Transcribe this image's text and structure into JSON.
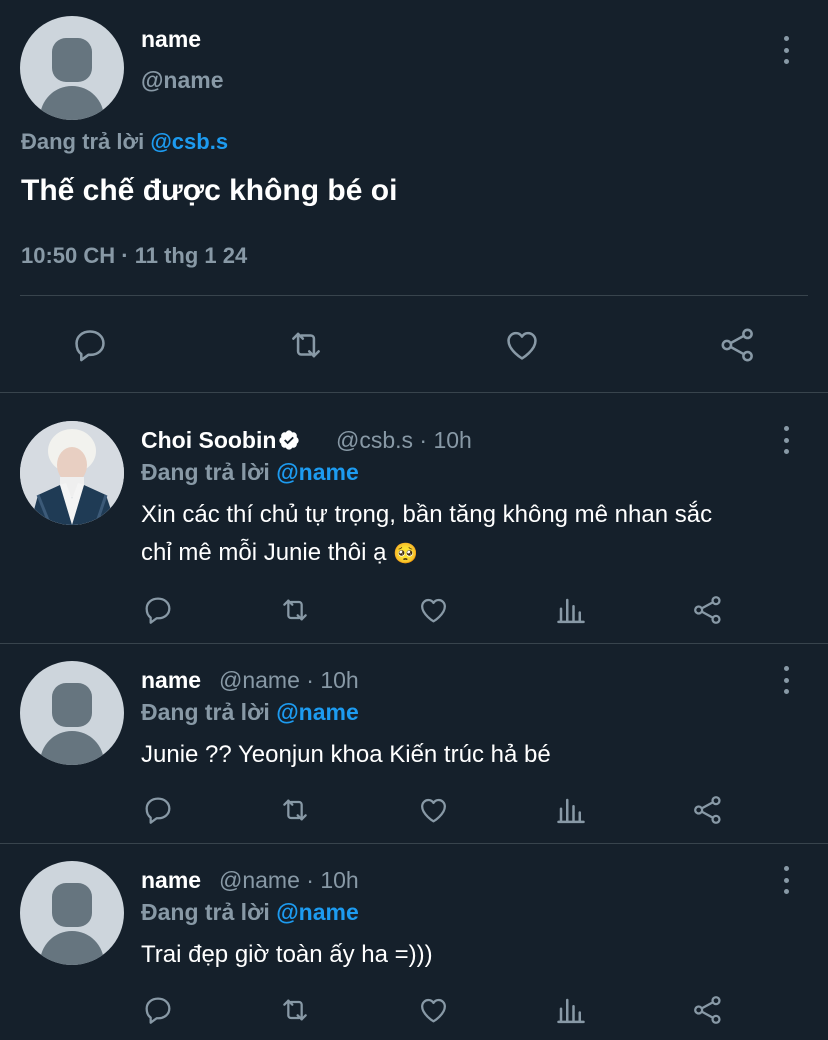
{
  "main_tweet": {
    "name": "name",
    "handle": "@name",
    "replying_prefix": "Đang trả lời",
    "replying_to": "@csb.s",
    "text": "Thế chế được không bé oi",
    "timestamp": "10:50 CH · 11 thg 1 24",
    "actions": [
      "reply-icon",
      "retweet-icon",
      "like-icon",
      "share-icon"
    ]
  },
  "replies": [
    {
      "name": "Choi Soobin",
      "verified": true,
      "meta": "@csb.s · 10h",
      "replying_prefix": "Đang trả lời",
      "replying_to": "@name",
      "text_line1": "Xin các thí chủ tự trọng, bần tăng không mê nhan sắc",
      "text_line2": "chỉ mê mỗi Junie thôi ạ",
      "emoji": "🥺"
    },
    {
      "name": "name",
      "meta": "@name · 10h",
      "replying_prefix": "Đang trả lời",
      "replying_to": "@name",
      "text_line1": "Junie ?? Yeonjun khoa Kiến trúc hả bé"
    },
    {
      "name": "name",
      "meta": "@name · 10h",
      "replying_prefix": "Đang trả lời",
      "replying_to": "@name",
      "text_line1": "Trai đẹp giờ toàn ấy ha =)))"
    }
  ],
  "colors": {
    "background": "#15202b",
    "muted": "#8899a6",
    "accent": "#1d9bf0",
    "divider": "#38444d"
  }
}
